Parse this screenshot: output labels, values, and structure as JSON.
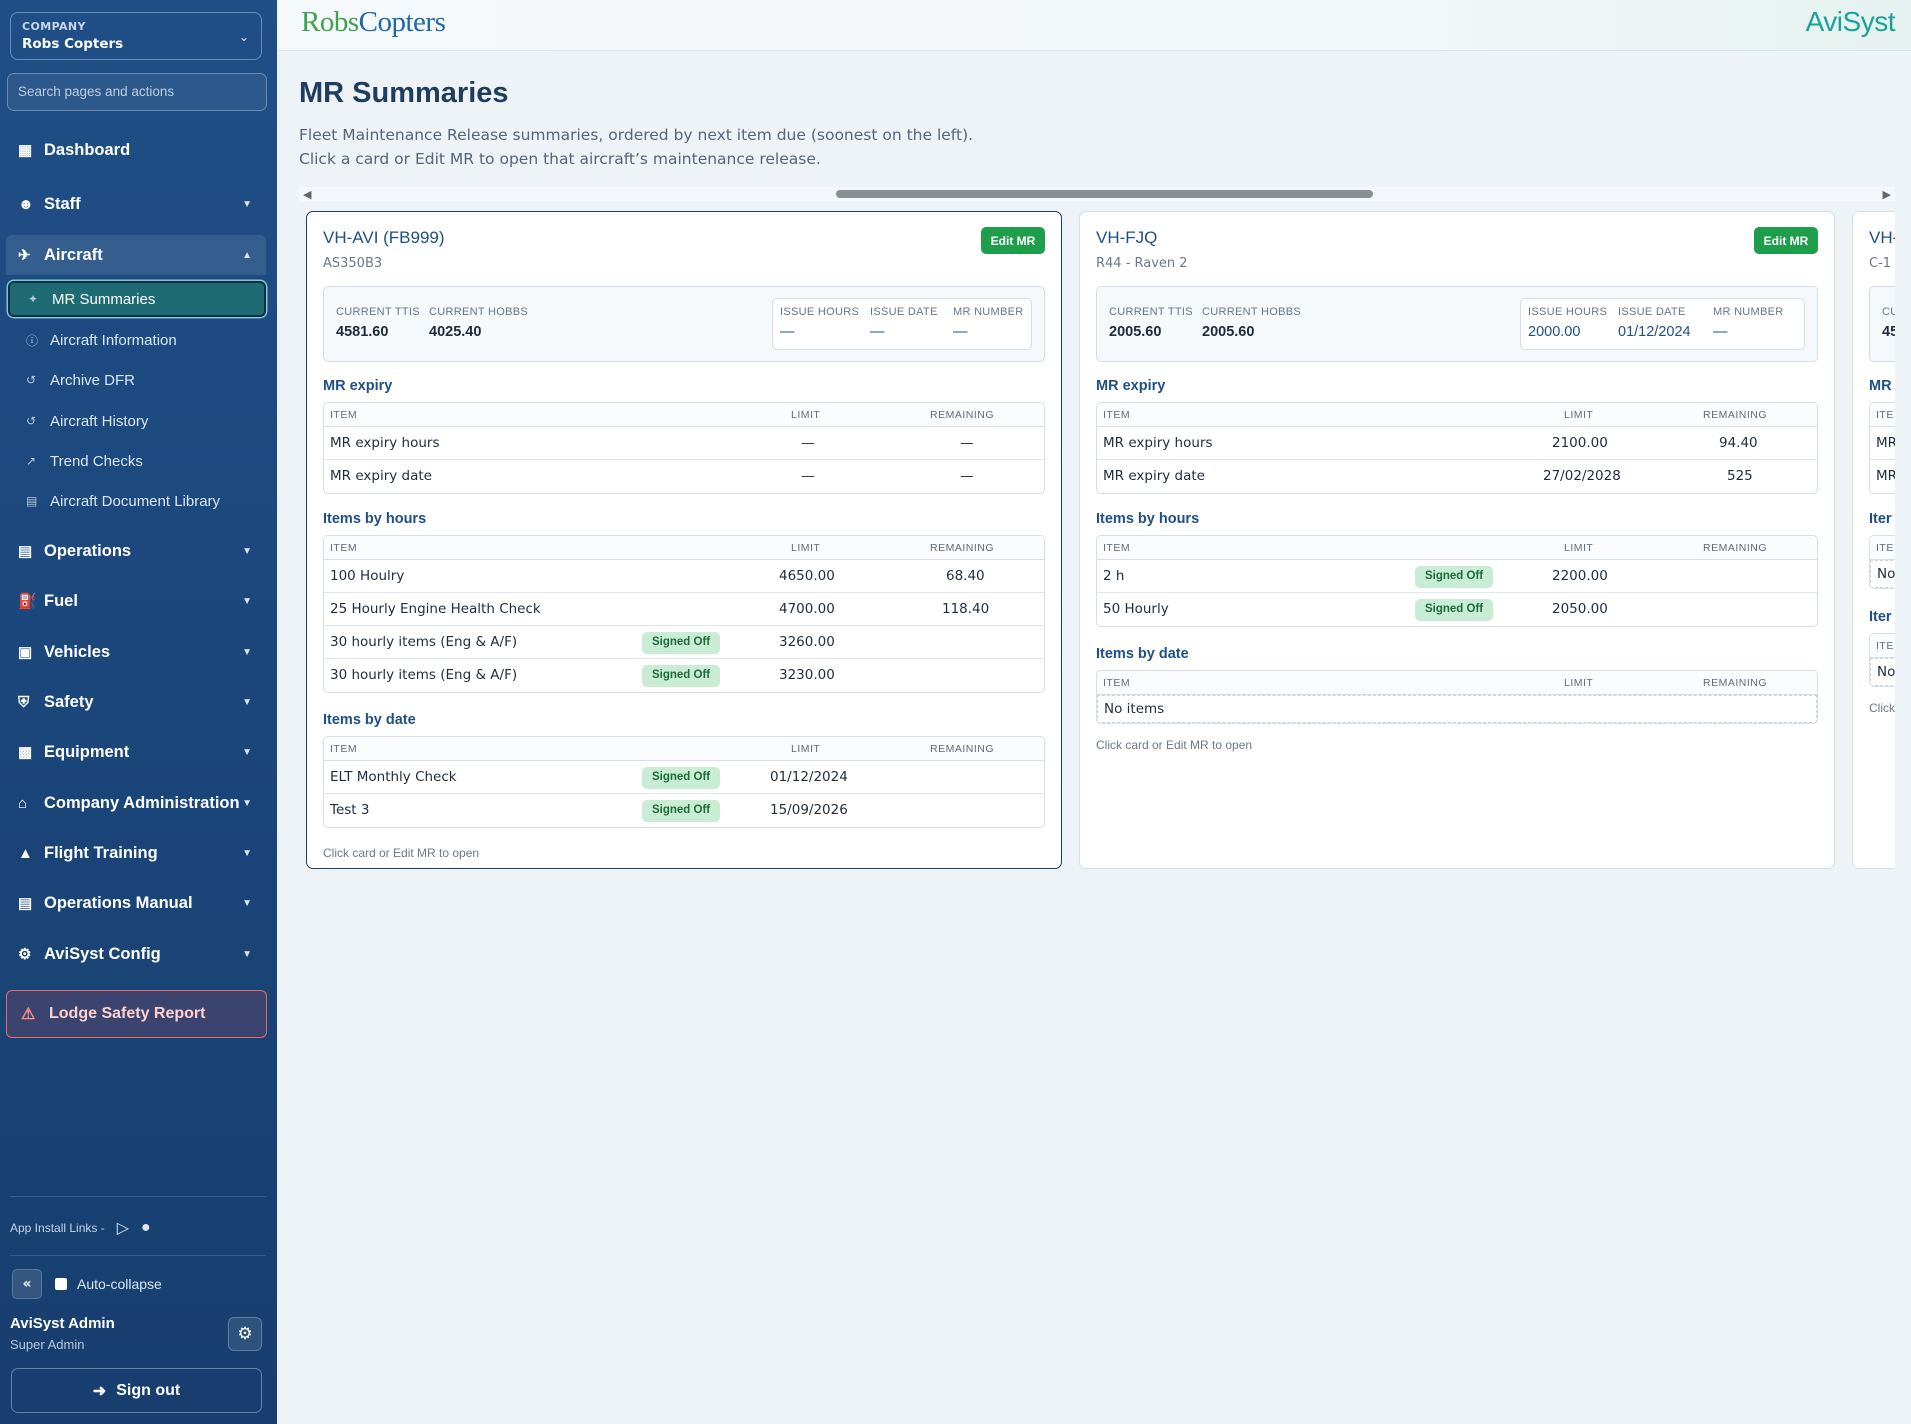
{
  "company": {
    "label": "COMPANY",
    "value": "Robs Copters"
  },
  "search": {
    "placeholder": "Search pages and actions"
  },
  "nav": {
    "dashboard": "Dashboard",
    "staff": "Staff",
    "aircraft": "Aircraft",
    "aircraft_sub": [
      "MR Summaries",
      "Aircraft Information",
      "Archive DFR",
      "Aircraft History",
      "Trend Checks",
      "Aircraft Document Library"
    ],
    "operations": "Operations",
    "fuel": "Fuel",
    "vehicles": "Vehicles",
    "safety": "Safety",
    "equipment": "Equipment",
    "company_admin": "Company Administration",
    "flight_training": "Flight Training",
    "operations_manual": "Operations Manual",
    "avisyst_config": "AviSyst Config",
    "lodge": "Lodge Safety Report"
  },
  "footer": {
    "install_links": "App Install Links -",
    "auto_collapse": "Auto-collapse",
    "user_name": "AviSyst Admin",
    "user_role": "Super Admin",
    "sign_out": "Sign out"
  },
  "brand": {
    "left_a": "Robs",
    "left_b": "Copters",
    "right": "AviSyst"
  },
  "page": {
    "title": "MR Summaries",
    "description": "Fleet Maintenance Release summaries, ordered by next item due (soonest on the left). Click a card or Edit MR to open that aircraft’s maintenance release."
  },
  "labels": {
    "edit_mr": "Edit MR",
    "current_ttis": "CURRENT TTIS",
    "current_hobbs": "CURRENT HOBBS",
    "issue_hours": "ISSUE HOURS",
    "issue_date": "ISSUE DATE",
    "mr_number": "MR NUMBER",
    "mr_expiry": "MR expiry",
    "items_by_hours": "Items by hours",
    "items_by_date": "Items by date",
    "col_item": "ITEM",
    "col_limit": "LIMIT",
    "col_remaining": "REMAINING",
    "signed_off": "Signed Off",
    "no_items": "No items",
    "card_foot": "Click card or Edit MR to open",
    "mr_expiry_hours": "MR expiry hours",
    "mr_expiry_date": "MR expiry date"
  },
  "cards": [
    {
      "title": "VH-AVI (FB999)",
      "model": "AS350B3",
      "ttis": "4581.60",
      "hobbs": "4025.40",
      "issue_hours": "—",
      "issue_date": "—",
      "mr_number": "—",
      "expiry": [
        {
          "limit": "—",
          "remaining": "—"
        },
        {
          "limit": "—",
          "remaining": "—"
        }
      ],
      "hours": [
        {
          "item": "100 Houlry",
          "limit": "4650.00",
          "remaining": "68.40"
        },
        {
          "item": "25 Hourly Engine Health Check",
          "limit": "4700.00",
          "remaining": "118.40"
        },
        {
          "item": "30 hourly items (Eng & A/F)",
          "limit": "3260.00",
          "remaining": ""
        },
        {
          "item": "30 hourly items (Eng & A/F)",
          "limit": "3230.00",
          "remaining": ""
        }
      ],
      "dates": [
        {
          "item": "ELT Monthly Check",
          "limit": "01/12/2024",
          "remaining": ""
        },
        {
          "item": "Test 3",
          "limit": "15/09/2026",
          "remaining": ""
        }
      ]
    },
    {
      "title": "VH-FJQ",
      "model": "R44 - Raven 2",
      "ttis": "2005.60",
      "hobbs": "2005.60",
      "issue_hours": "2000.00",
      "issue_date": "01/12/2024",
      "mr_number": "—",
      "expiry": [
        {
          "limit": "2100.00",
          "remaining": "94.40"
        },
        {
          "limit": "27/02/2028",
          "remaining": "525"
        }
      ],
      "hours": [
        {
          "item": "2 h",
          "limit": "2200.00",
          "remaining": ""
        },
        {
          "item": "50 Hourly",
          "limit": "2050.00",
          "remaining": ""
        }
      ]
    },
    {
      "title": "VH-",
      "model": "C-1",
      "ttis_label": "CU",
      "ttis": "45",
      "sec_mr": "MR",
      "col_item": "ITE",
      "row_mr": "MR",
      "sec_items": "Iter",
      "no_items": "No",
      "foot": "Click"
    }
  ]
}
